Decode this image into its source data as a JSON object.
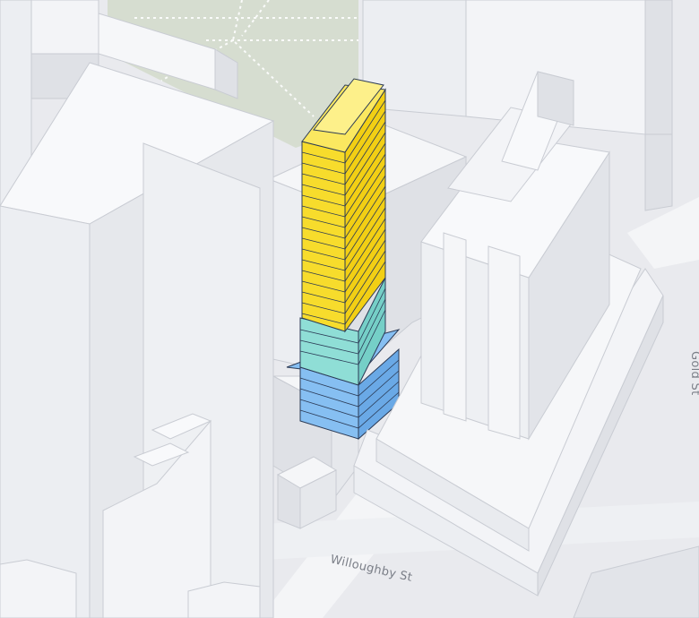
{
  "map": {
    "streets": [
      {
        "name": "Willoughby St"
      },
      {
        "name": "Gold St"
      }
    ],
    "colors": {
      "background": "#e9eaee",
      "park": "#d6ddd0",
      "building_top": "#f8f9fb",
      "building_left": "#eceef2",
      "building_right": "#dfe1e6",
      "building_edge": "#c9ccd3",
      "highlight_upper": "#f7dc2c",
      "highlight_middle": "#8fded6",
      "highlight_base": "#86bff2",
      "highlight_edge": "#2b3a55"
    }
  }
}
